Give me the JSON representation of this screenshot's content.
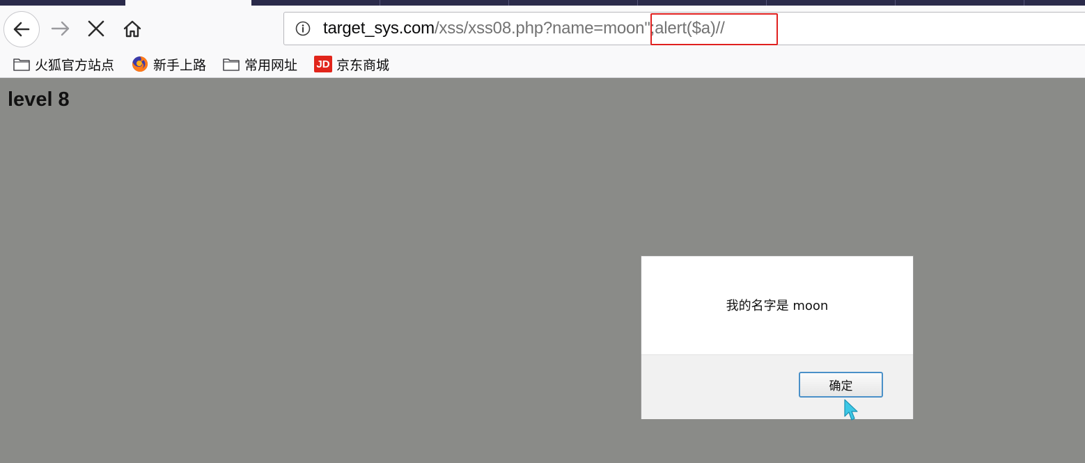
{
  "browser": {
    "url": {
      "host": "target_sys.com",
      "path": "/xss/xss08.php?name=moon",
      "payload": "\";alert($a)//"
    },
    "icons": {
      "back": "back-arrow-icon",
      "forward": "forward-arrow-icon",
      "stop": "stop-icon",
      "home": "home-icon",
      "info": "info-icon"
    },
    "highlight_color": "#e0201f"
  },
  "bookmarks": [
    {
      "label": "火狐官方站点",
      "icon": "folder-icon"
    },
    {
      "label": "新手上路",
      "icon": "firefox-icon"
    },
    {
      "label": "常用网址",
      "icon": "folder-icon"
    },
    {
      "label": "京东商城",
      "icon": "jd-icon",
      "icon_text": "JD"
    }
  ],
  "page": {
    "heading": "level 8",
    "background": "#8a8b88"
  },
  "dialog": {
    "message": "我的名字是 moon",
    "ok_label": "确定"
  }
}
